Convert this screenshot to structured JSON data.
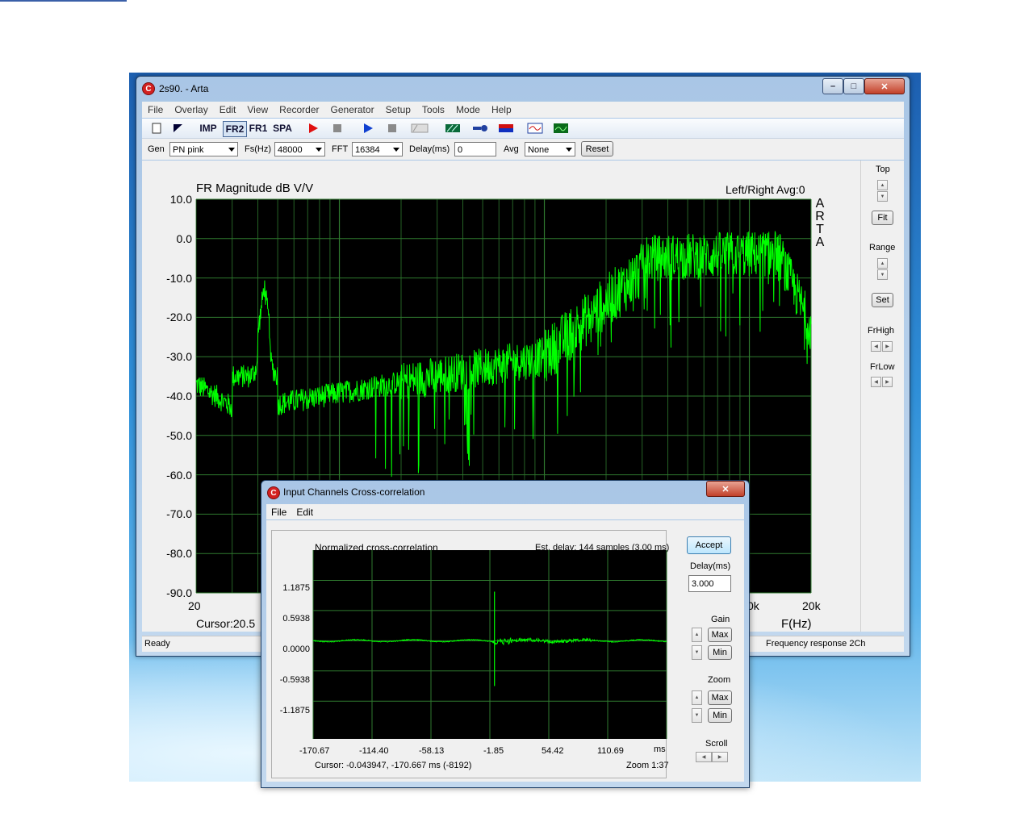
{
  "main_window": {
    "title": "2s90. - Arta",
    "menu": [
      "File",
      "Overlay",
      "Edit",
      "View",
      "Recorder",
      "Generator",
      "Setup",
      "Tools",
      "Mode",
      "Help"
    ],
    "toolbar": {
      "imp": "IMP",
      "fr2": "FR2",
      "fr1": "FR1",
      "spa": "SPA"
    },
    "controls": {
      "gen_label": "Gen",
      "gen_value": "PN pink",
      "fs_label": "Fs(Hz)",
      "fs_value": "48000",
      "fft_label": "FFT",
      "fft_value": "16384",
      "delay_label": "Delay(ms)",
      "delay_value": "0",
      "avg_label": "Avg",
      "avg_value": "None",
      "reset": "Reset"
    },
    "plot": {
      "title": "FR Magnitude dB V/V",
      "info": "Left/Right  Avg:0",
      "watermark": [
        "A",
        "R",
        "T",
        "A"
      ],
      "y_ticks": [
        "10.0",
        "0.0",
        "-10.0",
        "-20.0",
        "-30.0",
        "-40.0",
        "-50.0",
        "-60.0",
        "-70.0",
        "-80.0",
        "-90.0"
      ],
      "x_ticks": {
        "left": "20",
        "k": "0k",
        "right": "20k"
      },
      "xlabel": "F(Hz)",
      "cursor": "Cursor:20.5"
    },
    "side_panel": {
      "top": "Top",
      "fit": "Fit",
      "range": "Range",
      "set": "Set",
      "frhigh": "FrHigh",
      "frlow": "FrLow"
    },
    "status": {
      "left": "Ready",
      "right": "Frequency response 2Ch"
    }
  },
  "dialog": {
    "title": "Input Channels Cross-correlation",
    "menu": [
      "File",
      "Edit"
    ],
    "plot_title": "Normalized cross-correlation",
    "est_delay": "Est. delay: 144 samples (3.00 ms)",
    "y_ticks": [
      "1.1875",
      "0.5938",
      "0.0000",
      "-0.5938",
      "-1.1875"
    ],
    "x_ticks": [
      "-170.67",
      "-114.40",
      "-58.13",
      "-1.85",
      "54.42",
      "110.69"
    ],
    "x_unit": "ms",
    "cursor": "Cursor: -0.043947, -170.667 ms  (-8192)",
    "zoom_text": "Zoom 1:37",
    "accept": "Accept",
    "delay_label": "Delay(ms)",
    "delay_value": "3.000",
    "gain_label": "Gain",
    "gain_max": "Max",
    "gain_min": "Min",
    "zoom_label": "Zoom",
    "zoom_max": "Max",
    "zoom_min": "Min",
    "scroll_label": "Scroll"
  },
  "colors": {
    "trace": "#00ff00",
    "grid": "#2f7a2f",
    "plot_bg": "#000000"
  }
}
